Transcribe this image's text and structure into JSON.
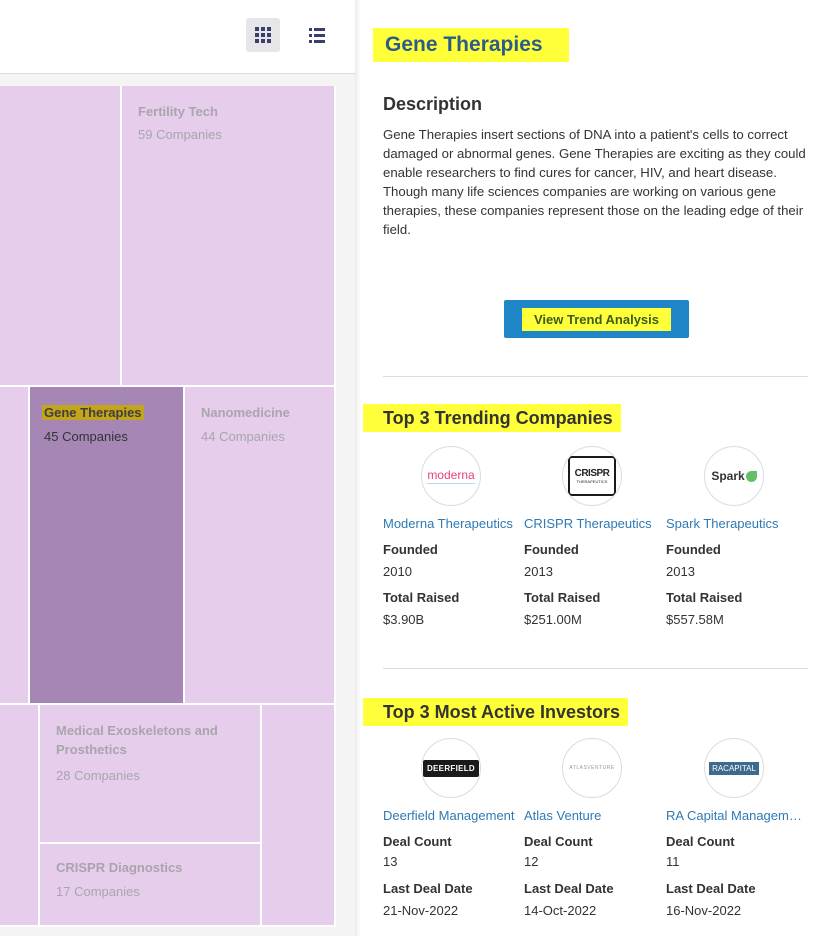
{
  "toolbar": {
    "grid_icon": "grid-view-icon",
    "list_icon": "list-view-icon"
  },
  "treemap": {
    "tiles": [
      {
        "name": "",
        "count": ""
      },
      {
        "name": "Fertility Tech",
        "count": "59 Companies"
      },
      {
        "name": "",
        "count": ""
      },
      {
        "name": "Gene Therapies",
        "count": "45 Companies"
      },
      {
        "name": "Nanomedicine",
        "count": "44 Companies"
      },
      {
        "name": "",
        "count": ""
      },
      {
        "name": "Medical Exoskeletons and Prosthetics",
        "count": "28 Companies"
      },
      {
        "name": "",
        "count": ""
      },
      {
        "name": "CRISPR Diagnostics",
        "count": "17 Companies"
      }
    ]
  },
  "panel": {
    "title": "Gene Therapies",
    "description_heading": "Description",
    "description": "Gene Therapies insert sections of DNA into a patient's cells to correct damaged or abnormal genes. Gene Therapies are exciting as they could enable researchers to find cures for cancer, HIV, and heart disease. Though many life sciences companies are working on various gene therapies, these companies represent those on the leading edge of their field.",
    "trend_button": "View Trend Analysis",
    "companies_heading": "Top 3 Trending Companies",
    "companies": [
      {
        "name": "Moderna Therapeutics",
        "logo_text": "moderna",
        "founded_label": "Founded",
        "founded": "2010",
        "raised_label": "Total Raised",
        "raised": "$3.90B"
      },
      {
        "name": "CRISPR Therapeutics",
        "logo_text": "CRISPR",
        "logo_sub": "THERAPEUTICS",
        "founded_label": "Founded",
        "founded": "2013",
        "raised_label": "Total Raised",
        "raised": "$251.00M"
      },
      {
        "name": "Spark Therapeutics",
        "logo_text": "Spark",
        "founded_label": "Founded",
        "founded": "2013",
        "raised_label": "Total Raised",
        "raised": "$557.58M"
      }
    ],
    "investors_heading": "Top 3 Most Active Investors",
    "investors": [
      {
        "name": "Deerfield Management",
        "logo_text": "DEERFIELD",
        "deals_label": "Deal Count",
        "deals": "13",
        "last_label": "Last Deal Date",
        "last": "21-Nov-2022"
      },
      {
        "name": "Atlas Venture",
        "logo_text": "ATLASVENTURE",
        "deals_label": "Deal Count",
        "deals": "12",
        "last_label": "Last Deal Date",
        "last": "14-Oct-2022"
      },
      {
        "name": "RA Capital Management",
        "logo_text": "RACAPITAL",
        "deals_label": "Deal Count",
        "deals": "11",
        "last_label": "Last Deal Date",
        "last": "16-Nov-2022"
      }
    ]
  },
  "colors": {
    "tile": "#e5cdeb",
    "tile_selected": "#a686b5",
    "link": "#2e7ab5",
    "title": "#2c5d8a",
    "button": "#1e86c6",
    "highlight": "#ffff3a"
  }
}
